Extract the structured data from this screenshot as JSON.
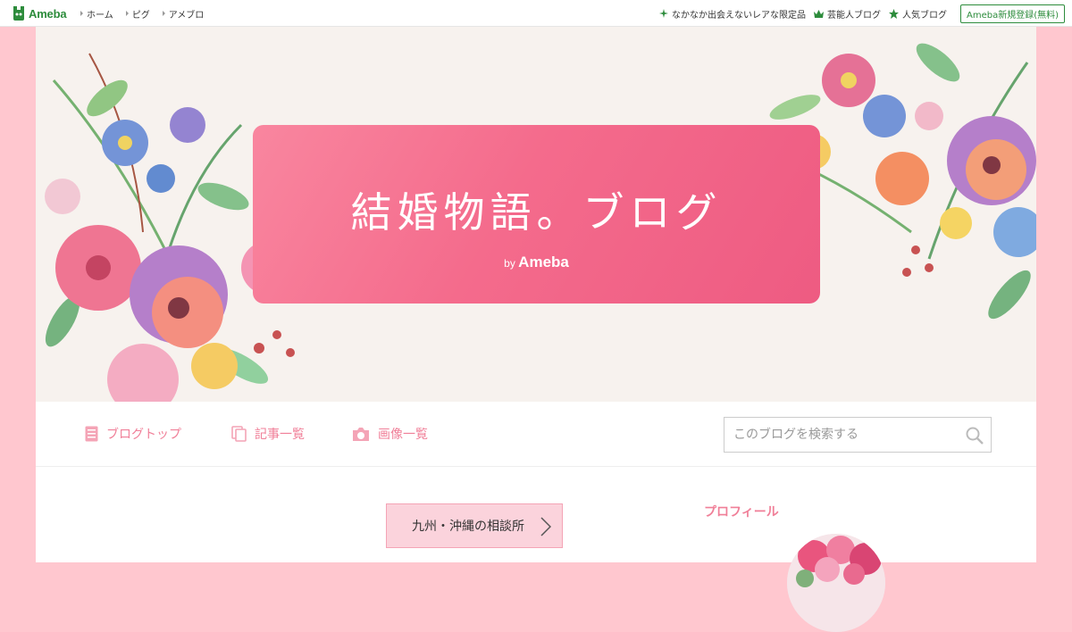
{
  "topbar": {
    "logo_text": "Ameba",
    "nav": [
      "ホーム",
      "ピグ",
      "アメブロ"
    ],
    "right_links": [
      {
        "icon": "sparkle-icon",
        "label": "なかなか出会えないレアな限定品"
      },
      {
        "icon": "crown-icon",
        "label": "芸能人ブログ"
      },
      {
        "icon": "star-icon",
        "label": "人気ブログ"
      }
    ],
    "register_label": "Ameba新規登録(無料)"
  },
  "header": {
    "title": "結婚物語。ブログ",
    "by_prefix": "by",
    "by_brand": "Ameba"
  },
  "nav": {
    "blog_top": "ブログトップ",
    "articles": "記事一覧",
    "images": "画像一覧",
    "search_placeholder": "このブログを検索する"
  },
  "main": {
    "consult_button": "九州・沖縄の相談所"
  },
  "sidebar": {
    "profile_title": "プロフィール"
  },
  "colors": {
    "accent_pink": "#f07f98",
    "ameba_green": "#2d8c3c",
    "page_bg": "#ffc7cf"
  }
}
